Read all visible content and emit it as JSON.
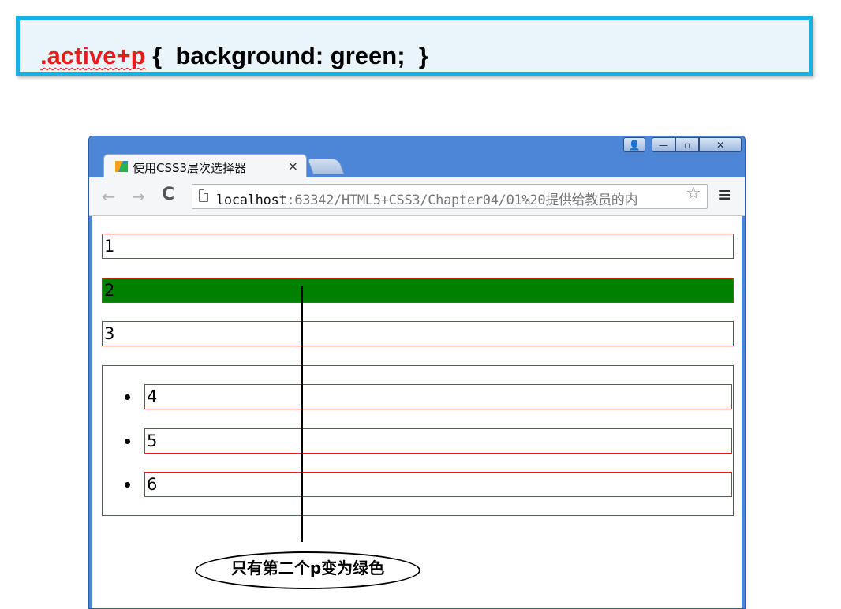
{
  "banner": {
    "selector": ".active+p",
    "declaration": " {  background: green;  }"
  },
  "window": {
    "tab_title": "使用CSS3层次选择器",
    "tab_close": "×",
    "controls": {
      "user": "👤",
      "minimize": "—",
      "maximize": "▫",
      "close": "✕"
    }
  },
  "toolbar": {
    "back": "←",
    "forward": "→",
    "reload": "C",
    "url_host": "localhost",
    "url_path": ":63342/HTML5+CSS3/Chapter04/01%20提供给教员的内",
    "star": "☆",
    "menu": "≡"
  },
  "page": {
    "paragraphs": [
      "1",
      "2",
      "3"
    ],
    "list_items": [
      "4",
      "5",
      "6"
    ]
  },
  "annotation": {
    "callout": "只有第二个p变为绿色"
  },
  "colors": {
    "selector_red": "#ec1b1b",
    "banner_border": "#17b1e6",
    "highlight_green": "#008000",
    "outline_red": "#e61e1e"
  }
}
